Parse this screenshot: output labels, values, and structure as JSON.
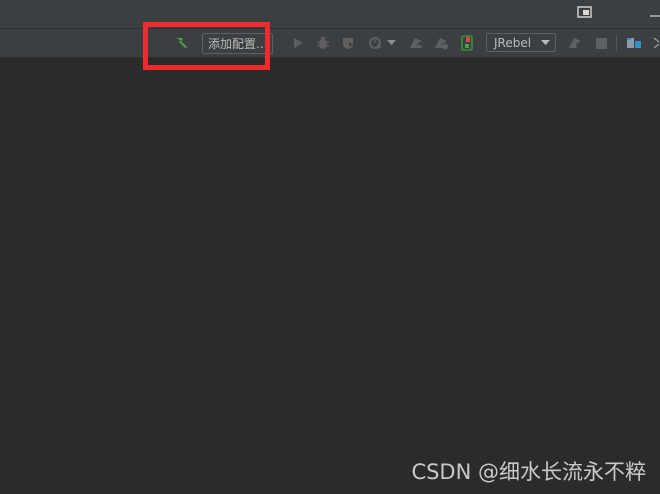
{
  "toolbar": {
    "add_config_label": "添加配置...",
    "jrebel_label": "JRebel",
    "icons": [
      "build-hammer-icon",
      "run-icon",
      "debug-icon",
      "coverage-icon",
      "profile-icon",
      "dropdown-icon",
      "jrebel-run-icon",
      "jrebel-debug-icon",
      "device-icon",
      "jrebel-config-icon",
      "jrebel-update-icon",
      "stop-icon",
      "project-structure-icon",
      "more-icon"
    ],
    "hammer_color": "#4a9e4e"
  },
  "watermark": {
    "text": "CSDN @细水长流永不粹"
  },
  "colors": {
    "highlight": "#f02b30",
    "background": "#2b2b2b",
    "toolbar": "#3c3f41"
  }
}
